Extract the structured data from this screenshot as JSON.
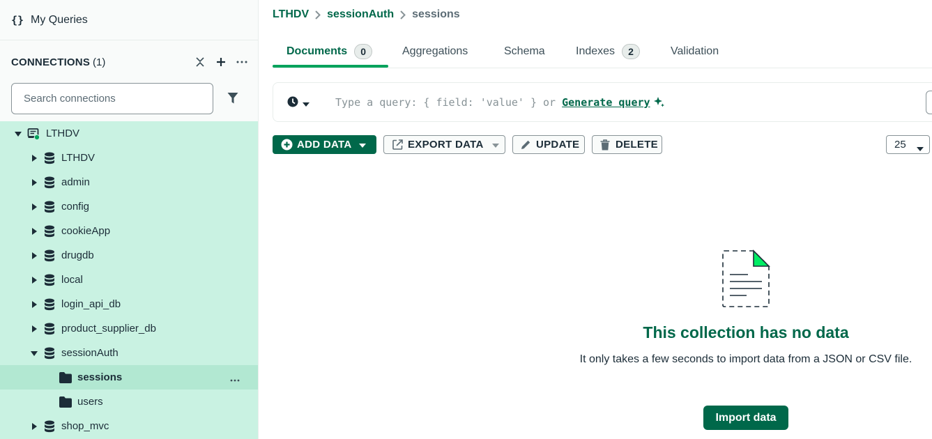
{
  "sidebar": {
    "my_queries": {
      "icon": "braces-icon",
      "braces": "{}",
      "label": "My Queries"
    },
    "connections": {
      "title": "CONNECTIONS",
      "count": "(1)",
      "search_placeholder": "Search connections"
    },
    "tree": [
      {
        "label": "LTHDV",
        "type": "connection",
        "expanded": true
      },
      {
        "label": "LTHDV",
        "type": "database",
        "expanded": false
      },
      {
        "label": "admin",
        "type": "database",
        "expanded": false
      },
      {
        "label": "config",
        "type": "database",
        "expanded": false
      },
      {
        "label": "cookieApp",
        "type": "database",
        "expanded": false
      },
      {
        "label": "drugdb",
        "type": "database",
        "expanded": false
      },
      {
        "label": "local",
        "type": "database",
        "expanded": false
      },
      {
        "label": "login_api_db",
        "type": "database",
        "expanded": false
      },
      {
        "label": "product_supplier_db",
        "type": "database",
        "expanded": false
      },
      {
        "label": "sessionAuth",
        "type": "database",
        "expanded": true
      },
      {
        "label": "sessions",
        "type": "collection",
        "selected": true
      },
      {
        "label": "users",
        "type": "collection"
      },
      {
        "label": "shop_mvc",
        "type": "database",
        "expanded": false
      }
    ]
  },
  "breadcrumb": {
    "connection": "LTHDV",
    "database": "sessionAuth",
    "collection": "sessions"
  },
  "tabs": [
    {
      "label": "Documents",
      "badge": "0",
      "active": true
    },
    {
      "label": "Aggregations"
    },
    {
      "label": "Schema"
    },
    {
      "label": "Indexes",
      "badge": "2"
    },
    {
      "label": "Validation"
    }
  ],
  "query": {
    "placeholder_prefix": "Type a query: { field: 'value' } or ",
    "generate_link": "Generate query"
  },
  "toolbar": {
    "add_data": "ADD DATA",
    "export_data": "EXPORT DATA",
    "update": "UPDATE",
    "delete": "DELETE",
    "page_size": "25"
  },
  "empty_state": {
    "title": "This collection has no data",
    "description": "It only takes a few seconds to import data from a JSON or CSV file.",
    "import_button": "Import data"
  },
  "colors": {
    "brand_green": "#00684a",
    "accent_green": "#00a35c",
    "tree_bg": "#c9f2e2",
    "tree_selected": "#b2e8d2",
    "status_connected": "#00a35c"
  }
}
